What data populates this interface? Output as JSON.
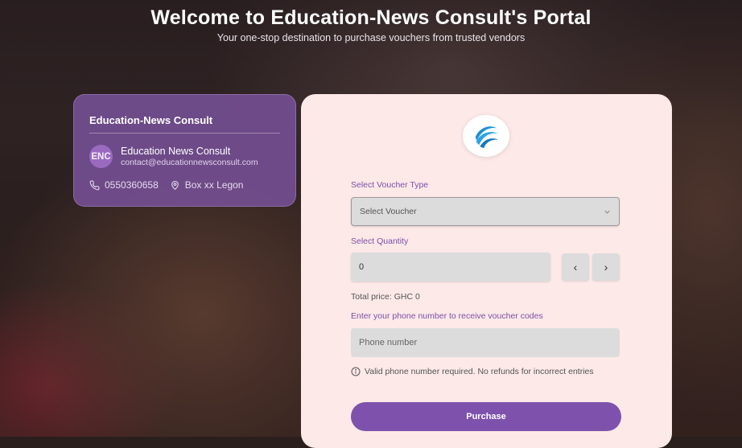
{
  "header": {
    "title": "Welcome to Education-News Consult's Portal",
    "subtitle": "Your one-stop destination to purchase vouchers from trusted vendors"
  },
  "info_card": {
    "org_name": "Education-News Consult",
    "avatar_initials": "ENC",
    "contact_name": "Education News Consult",
    "contact_email": "contact@educationnewsconsult.com",
    "phone": "0550360658",
    "address": "Box xx Legon",
    "phone_icon": "phone-icon",
    "location_icon": "location-pin-icon"
  },
  "form": {
    "logo_icon": "globe-logo-icon",
    "voucher_type_label": "Select Voucher Type",
    "voucher_type_value": "Select Voucher",
    "quantity_label": "Select Quantity",
    "quantity_value": "0",
    "decrement_glyph": "‹",
    "increment_glyph": "›",
    "total_price": "Total price: GHC 0",
    "phone_label": "Enter your phone number to receive voucher codes",
    "phone_placeholder": "Phone number",
    "note": "Valid phone number required. No refunds for incorrect entries",
    "purchase_label": "Purchase"
  },
  "colors": {
    "accent": "#7e52ac",
    "card_bg": "#fde9e8",
    "info_card_bg": "#76509a"
  }
}
